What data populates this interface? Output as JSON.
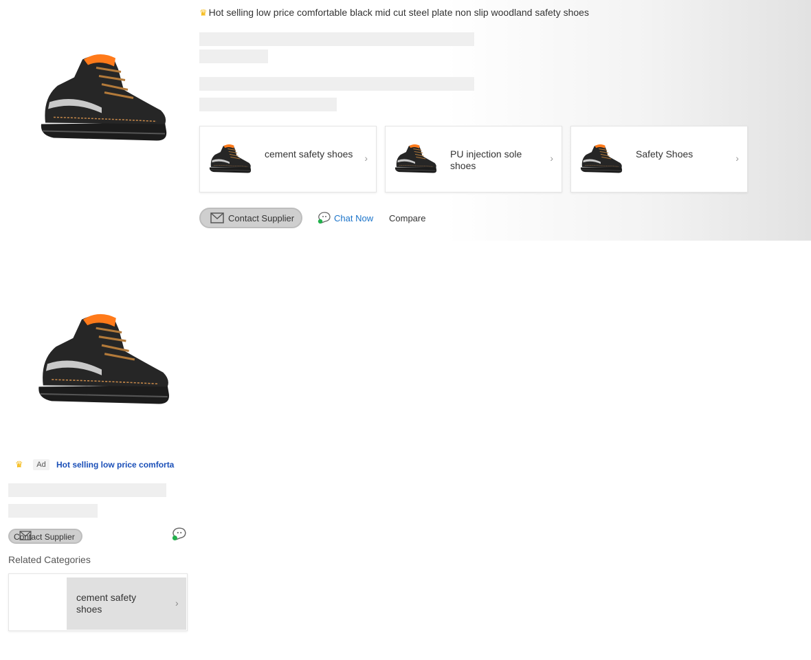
{
  "listing_top": {
    "image": "black-safety-boot-orange-collar",
    "title": "Hot selling low price comfortable black mid cut steel plate non slip woodland safety shoes",
    "related_categories": [
      {
        "label": "cement safety shoes",
        "image": "lace-up-boot-tan-sole"
      },
      {
        "label": "PU injection sole shoes",
        "image": "black-low-boot"
      },
      {
        "label": "Safety Shoes",
        "image": "black-leather-boot"
      }
    ],
    "actions": {
      "contact_label": "Contact Supplier",
      "chat_label": "Chat Now",
      "compare_label": "Compare"
    }
  },
  "listing_second": {
    "image": "black-safety-boot-orange-collar",
    "ad_label": "Ad",
    "title": "Hot selling low price comforta",
    "contact_label": "Contact Supplier",
    "related_title": "Related Categories",
    "related_category": {
      "label": "cement safety shoes"
    }
  },
  "colors": {
    "accent_link": "#1a73c9",
    "title_link": "#1a4fb8",
    "crown": "#f5b400",
    "online_dot": "#22b14c"
  }
}
